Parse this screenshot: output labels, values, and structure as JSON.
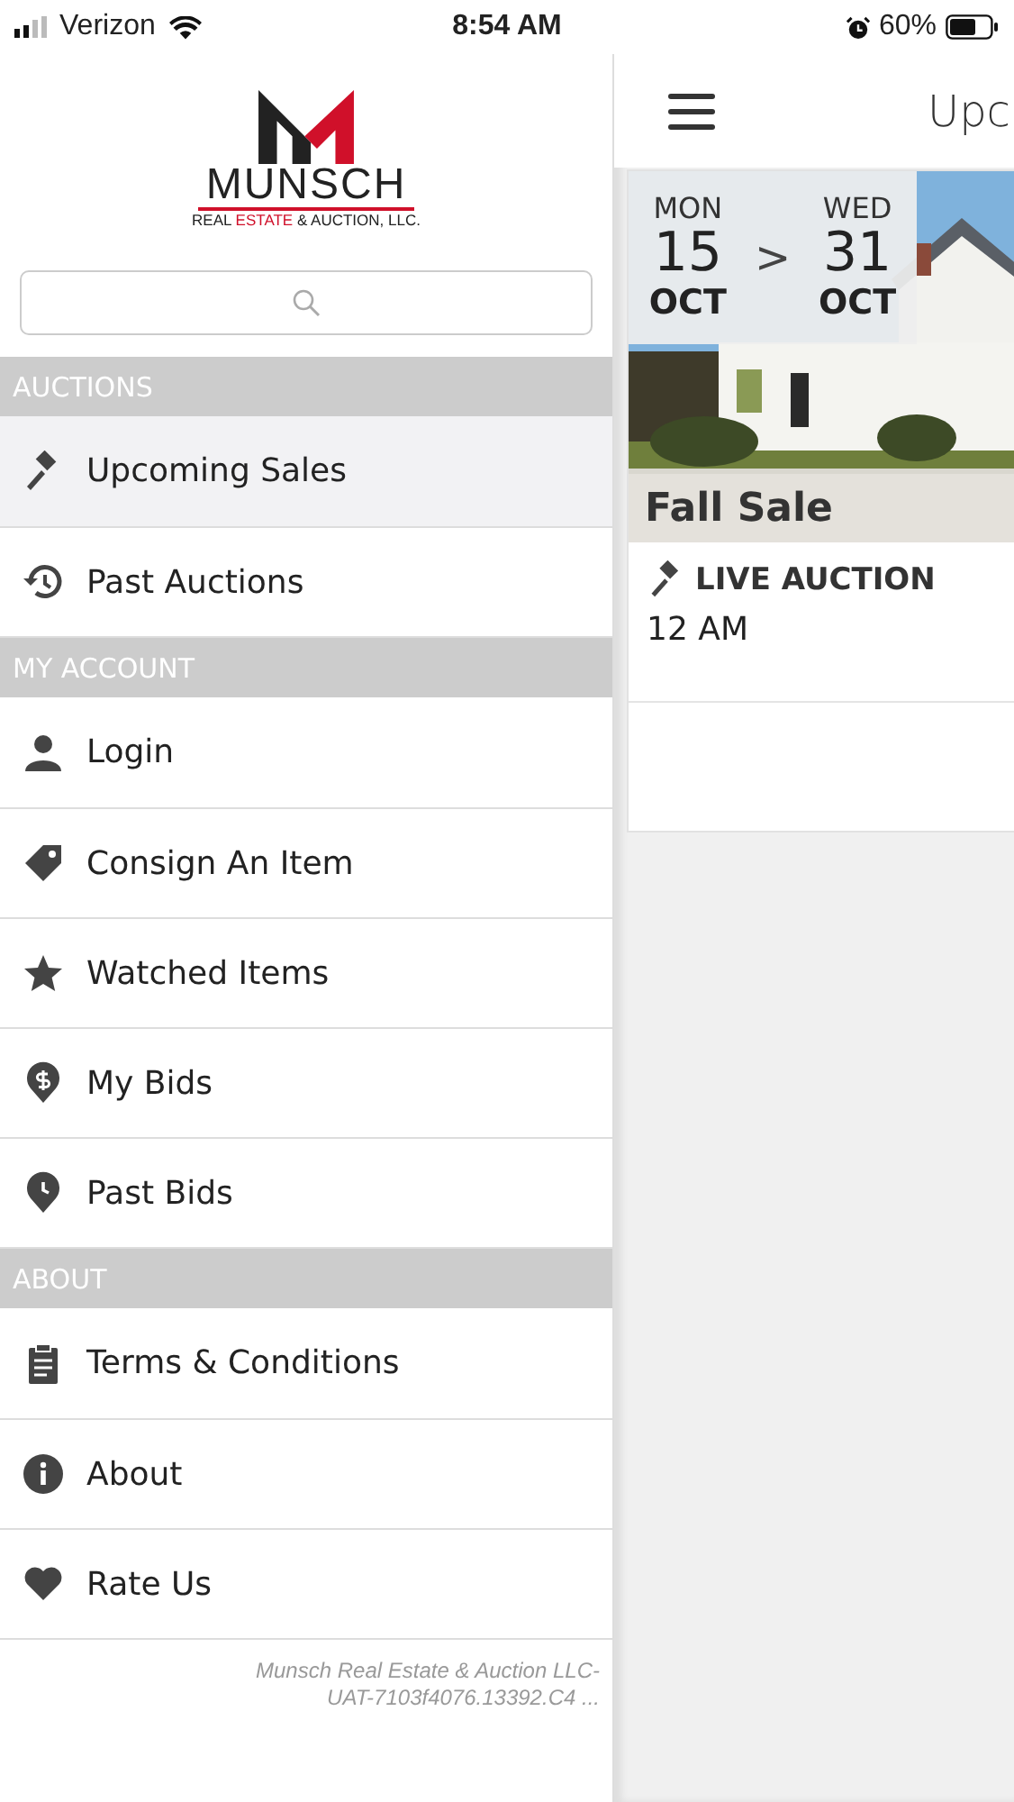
{
  "status_bar": {
    "carrier": "Verizon",
    "time": "8:54 AM",
    "battery": "60%"
  },
  "sidebar": {
    "logo": {
      "wordmark": "MUNSCH",
      "tagline": [
        {
          "text": "REAL ",
          "color": "#222222"
        },
        {
          "text": "ESTATE",
          "color": "#d0102a"
        },
        {
          "text": " & AUCTION, LLC.",
          "color": "#222222"
        }
      ]
    },
    "sections": [
      {
        "title": "AUCTIONS",
        "items": [
          {
            "label": "Upcoming Sales",
            "selected": true
          },
          {
            "label": "Past Auctions",
            "selected": false
          }
        ]
      },
      {
        "title": "MY ACCOUNT",
        "items": [
          {
            "label": "Login",
            "selected": false
          },
          {
            "label": "Consign An Item",
            "selected": false
          },
          {
            "label": "Watched Items",
            "selected": false
          },
          {
            "label": "My Bids",
            "selected": false
          },
          {
            "label": "Past Bids",
            "selected": false
          }
        ]
      },
      {
        "title": "ABOUT",
        "items": [
          {
            "label": "Terms & Conditions",
            "selected": false
          },
          {
            "label": "About",
            "selected": false
          },
          {
            "label": "Rate Us",
            "selected": false
          }
        ]
      }
    ],
    "footer": [
      "Munsch Real Estate & Auction LLC-",
      "UAT-7103f4076.13392.C4 ..."
    ]
  },
  "main": {
    "title": "Upc",
    "card": {
      "start": {
        "weekday": "MON",
        "day": "15",
        "month": "OCT"
      },
      "separator": ">",
      "end": {
        "weekday": "WED",
        "day": "31",
        "month": "OCT"
      },
      "name": "Fall Sale",
      "type": "LIVE AUCTION",
      "time": "12 AM"
    }
  }
}
